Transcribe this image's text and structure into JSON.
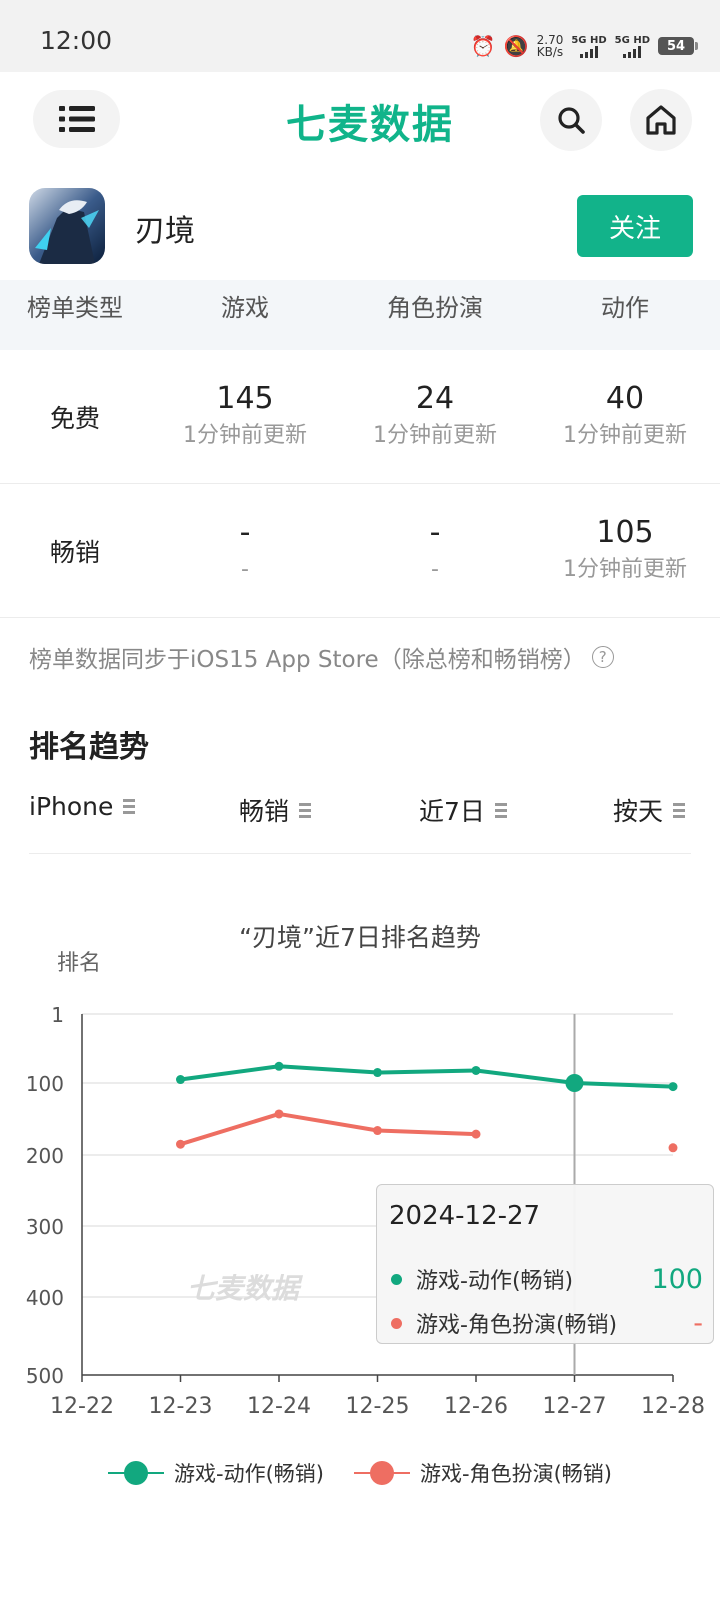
{
  "status_bar": {
    "time": "12:00",
    "net_speed_value": "2.70",
    "net_speed_unit": "KB/s",
    "sim1_label": "5G HD",
    "sim2_label": "5G HD",
    "battery": "54"
  },
  "header": {
    "logo_text": "七麦数据"
  },
  "app": {
    "name": "刃境",
    "follow_label": "关注"
  },
  "rank_table": {
    "headers": [
      "榜单类型",
      "游戏",
      "角色扮演",
      "动作"
    ],
    "rows": [
      {
        "label": "免费",
        "cells": [
          {
            "value": "145",
            "update": "1分钟前更新"
          },
          {
            "value": "24",
            "update": "1分钟前更新"
          },
          {
            "value": "40",
            "update": "1分钟前更新"
          }
        ]
      },
      {
        "label": "畅销",
        "cells": [
          {
            "value": "-",
            "update": "-"
          },
          {
            "value": "-",
            "update": "-"
          },
          {
            "value": "105",
            "update": "1分钟前更新"
          }
        ]
      }
    ]
  },
  "sync_note": "榜单数据同步于iOS15 App Store（除总榜和畅销榜）",
  "trend": {
    "title": "排名趋势",
    "filters": [
      "iPhone",
      "畅销",
      "近7日",
      "按天"
    ]
  },
  "colors": {
    "accent": "#12b38a",
    "series_green": "#12a87f",
    "series_red": "#ee6e62"
  },
  "tooltip": {
    "date": "2024-12-27",
    "rows": [
      {
        "label": "游戏-动作(畅销)",
        "value": "100"
      },
      {
        "label": "游戏-角色扮演(畅销)",
        "value": "-"
      }
    ]
  },
  "chart_data": {
    "type": "line",
    "title": "“刃境”近7日排名趋势",
    "ylabel": "排名",
    "watermark": "七麦数据",
    "y_inverted": true,
    "ylim": [
      1,
      500
    ],
    "yticks": [
      1,
      100,
      200,
      300,
      400,
      500
    ],
    "x": [
      "12-22",
      "12-23",
      "12-24",
      "12-25",
      "12-26",
      "12-27",
      "12-28"
    ],
    "grid": true,
    "legend_position": "bottom",
    "highlight_x": "12-27",
    "series": [
      {
        "name": "游戏-动作(畅销)",
        "values": [
          null,
          95,
          76,
          85,
          82,
          100,
          105
        ]
      },
      {
        "name": "游戏-角色扮演(畅销)",
        "values": [
          null,
          185,
          143,
          166,
          171,
          null,
          190
        ]
      }
    ]
  }
}
